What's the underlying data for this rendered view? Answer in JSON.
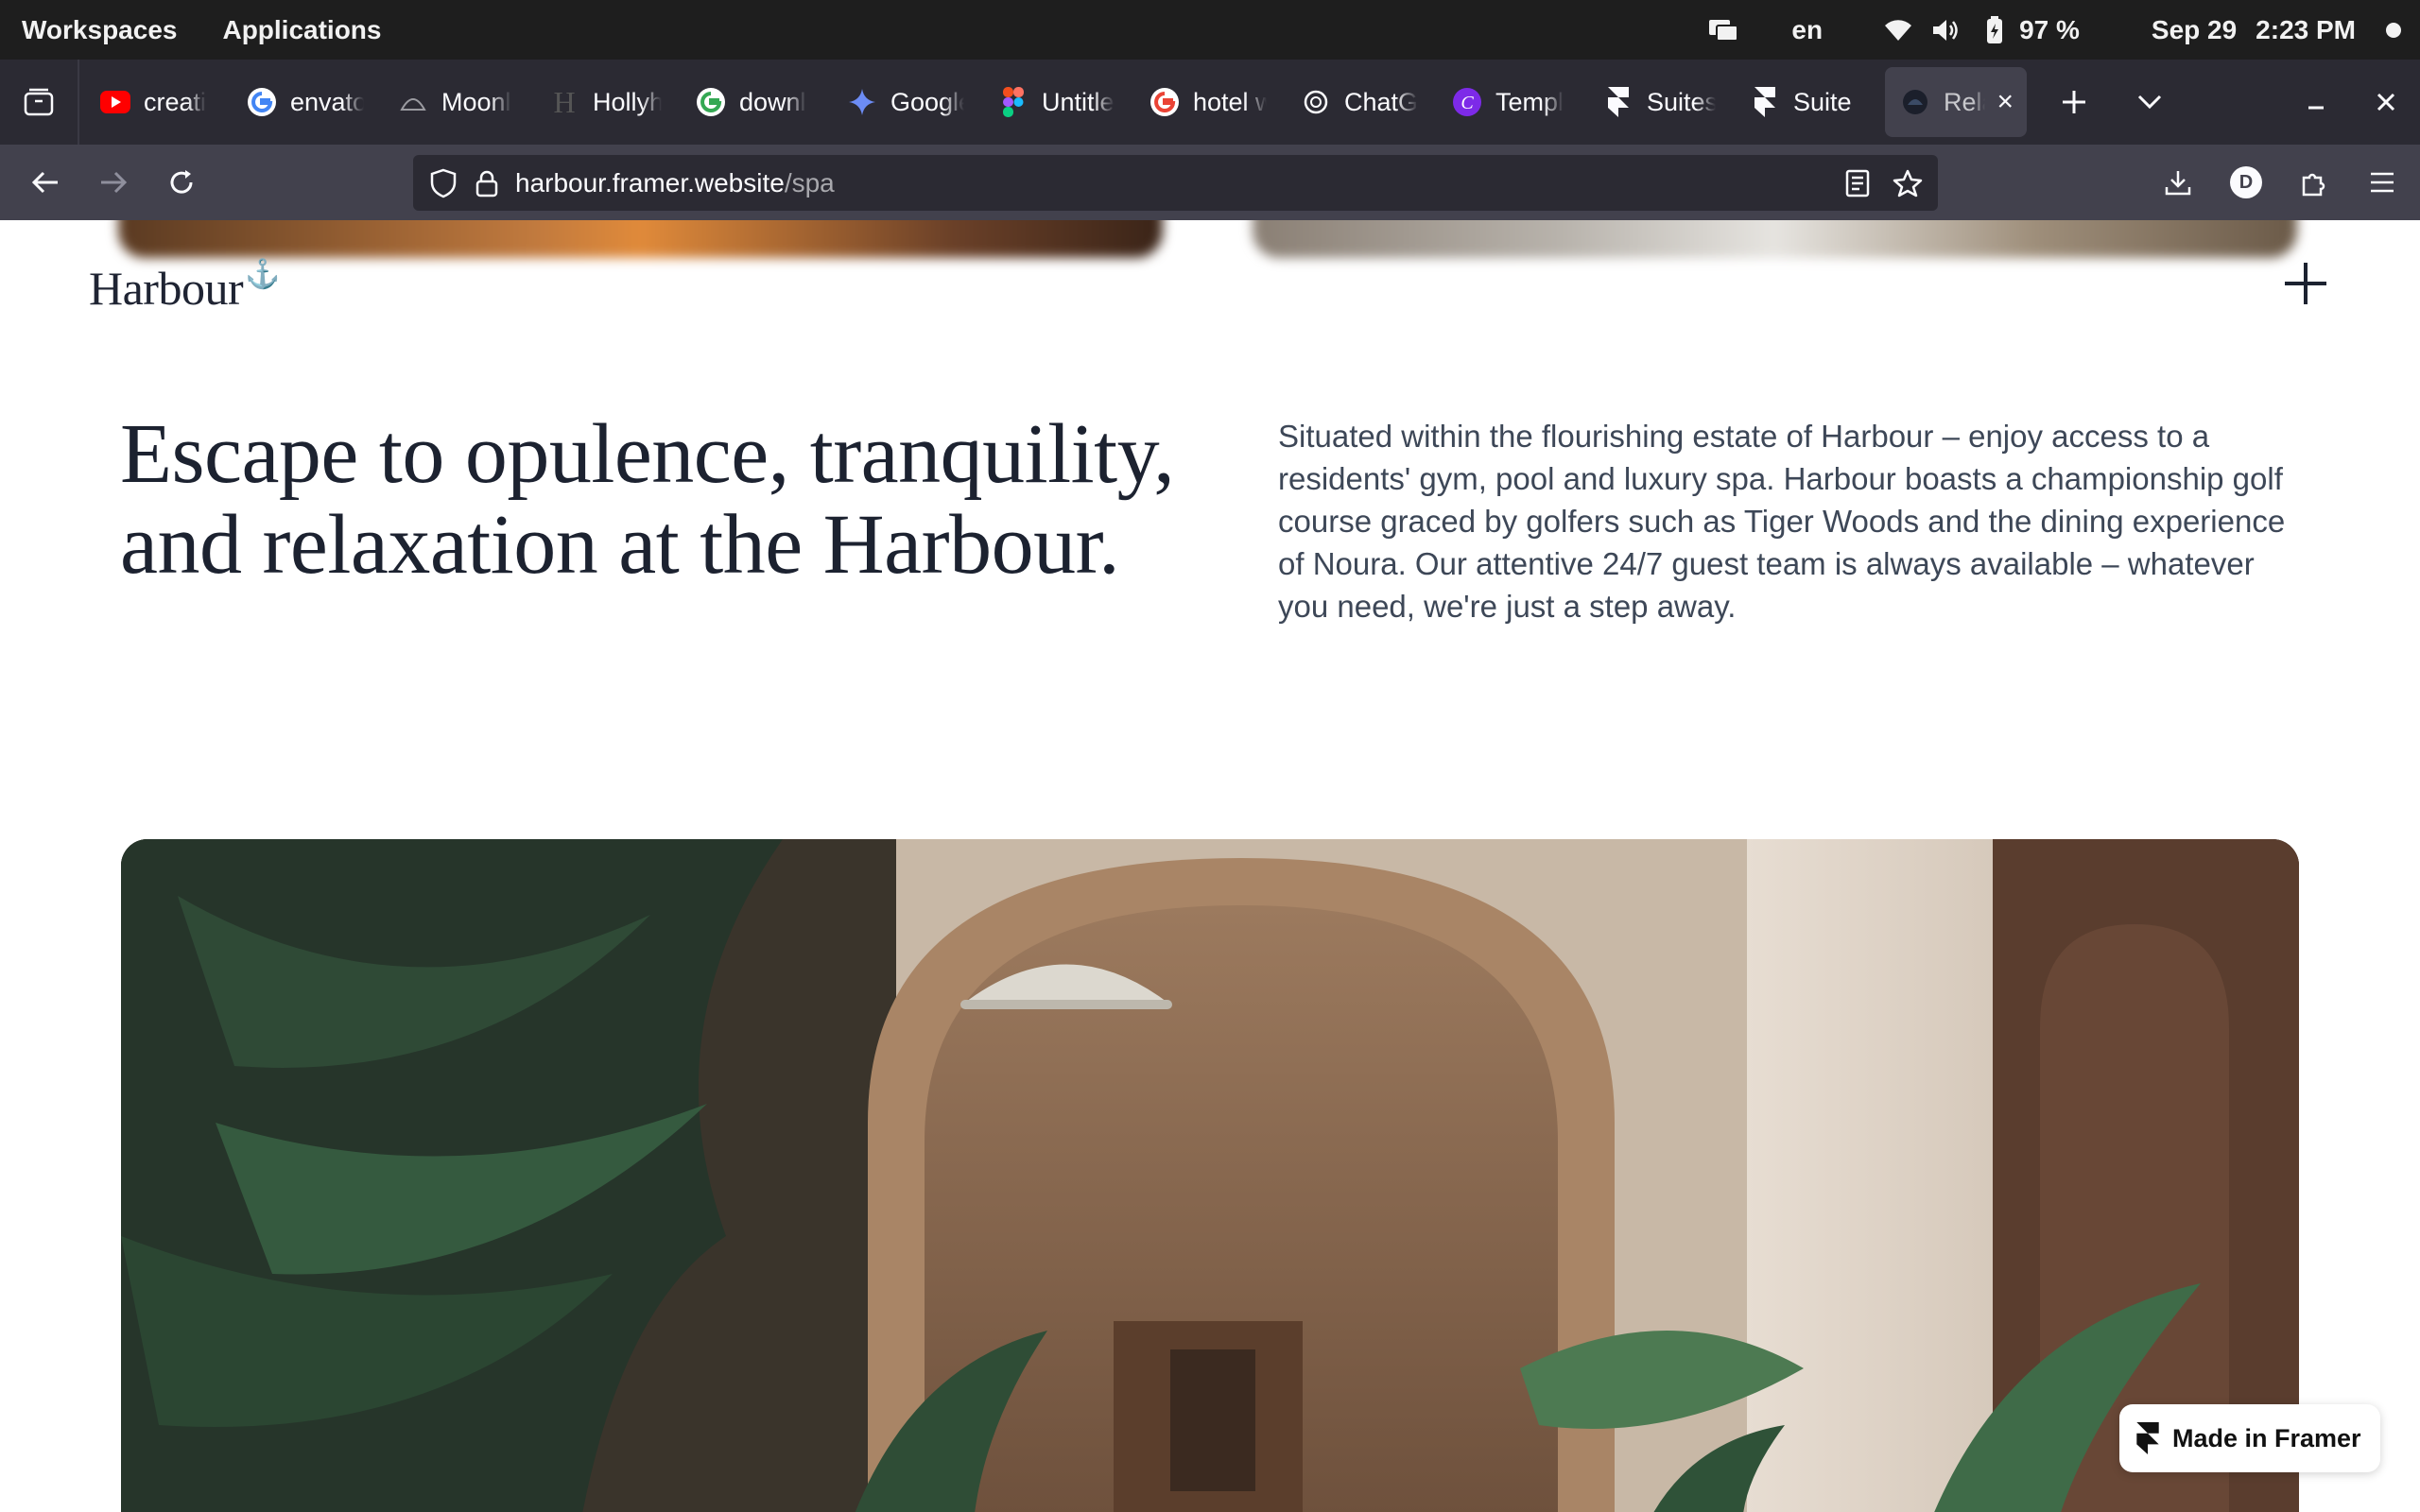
{
  "os_bar": {
    "workspaces": "Workspaces",
    "applications": "Applications",
    "keyboard_layout": "en",
    "battery": "97 %",
    "date": "Sep 29",
    "time": "2:23 PM"
  },
  "tabs": [
    {
      "label": "creati",
      "icon": "youtube-icon"
    },
    {
      "label": "envato",
      "icon": "google-icon"
    },
    {
      "label": "Moonl",
      "icon": "midjourney-icon"
    },
    {
      "label": "Hollyh",
      "icon": "h-logo-icon"
    },
    {
      "label": "downl",
      "icon": "google-icon"
    },
    {
      "label": "Google",
      "icon": "gemini-icon"
    },
    {
      "label": "Untitle",
      "icon": "figma-icon"
    },
    {
      "label": "hotel w",
      "icon": "google-icon"
    },
    {
      "label": "ChatGI",
      "icon": "openai-icon"
    },
    {
      "label": "Templ",
      "icon": "canva-icon"
    },
    {
      "label": "Suites",
      "icon": "framer-icon"
    },
    {
      "label": "Suite",
      "icon": "framer-icon"
    },
    {
      "label": "Rela",
      "icon": "harbour-favicon-icon",
      "active": true
    }
  ],
  "url": {
    "domain": "harbour.framer.website",
    "path": "/spa"
  },
  "profile_initial": "D",
  "page": {
    "logo": "Harbour",
    "logo_mark": "⚓",
    "headline": "Escape to opulence, tranquility, and relaxation at the Harbour.",
    "intro": "Situated within the flourishing estate of Harbour – enjoy access to a residents' gym, pool and luxury spa. Harbour boasts a championship golf course graced by golfers such as Tiger Woods and the dining experience of Noura. Our attentive 24/7 guest team is always available – whatever you need, we're just a step away.",
    "badge": "Made in Framer"
  },
  "colors": {
    "os_bar": "#1e1e1e",
    "tabstrip": "#2b2a33",
    "navbar": "#42414d",
    "headline": "#1c2230",
    "body_text": "#3d4757"
  }
}
